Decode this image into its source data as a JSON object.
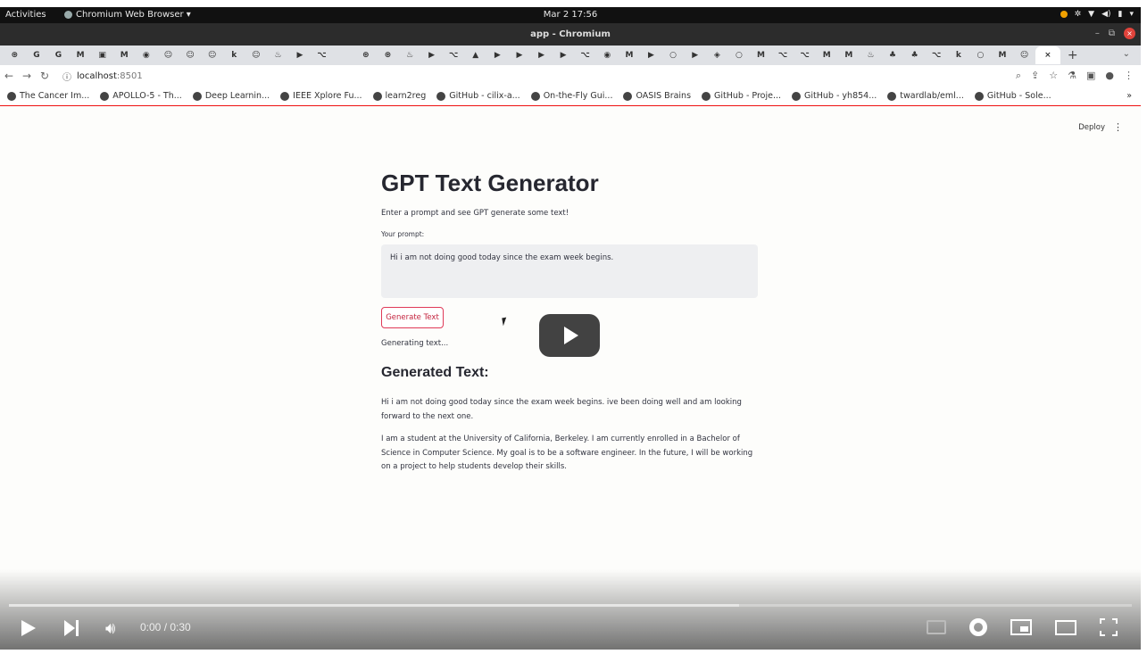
{
  "topbar": {
    "activities": "Activities",
    "app_menu": "Chromium Web Browser ▾",
    "clock": "Mar 2  17:56"
  },
  "window": {
    "title": "app - Chromium",
    "minimize": "–",
    "maximize": "⧉",
    "close": "×"
  },
  "tabs": {
    "icons": [
      "⊛",
      "G",
      "G",
      "M",
      "▣",
      "M",
      "◉",
      "☺",
      "☺",
      "☺",
      "k",
      "☺",
      "♨",
      "▶",
      "⌥",
      "",
      "⊛",
      "⊛",
      "♨",
      "▶",
      "⌥",
      "▲",
      "▶",
      "▶",
      "▶",
      "▶",
      "⌥",
      "◉",
      "M",
      "▶",
      "○",
      "▶",
      "◈",
      "○",
      "M",
      "⌥",
      "⌥",
      "M",
      "M",
      "♨",
      "♣",
      "♣",
      "⌥",
      "k",
      "○",
      "M",
      "☺"
    ],
    "active_label": "×",
    "new_tab": "+",
    "overflow": "⌄"
  },
  "address": {
    "back": "←",
    "forward": "→",
    "reload": "↻",
    "info": "ⓘ",
    "host": "localhost",
    "port": ":8501"
  },
  "bookmarks": [
    "The Cancer Im...",
    "APOLLO-5 - Th...",
    "Deep Learnin...",
    "IEEE Xplore Fu...",
    "learn2reg",
    "GitHub - cilix-a...",
    "On-the-Fly Gui...",
    "OASIS Brains",
    "GitHub - Proje...",
    "GitHub - yh854...",
    "twardlab/eml...",
    "GitHub - Sole..."
  ],
  "bookmarks_more": "»",
  "app": {
    "deploy": "Deploy",
    "menu": "⋮",
    "title": "GPT Text Generator",
    "subtitle": "Enter a prompt and see GPT generate some text!",
    "prompt_label": "Your prompt:",
    "prompt_value": "Hi i am not doing good today since the exam week begins.",
    "button_label": "Generate Text",
    "status": "Generating text...",
    "output_heading": "Generated Text:",
    "output_p1": "Hi i am not doing good today since the exam week begins. ive been doing well and am looking forward to the next one.",
    "output_p2": "I am a student at the University of California, Berkeley. I am currently enrolled in a Bachelor of Science in Computer Science. My goal is to be a software engineer. In the future, I will be working on a project to help students develop their skills."
  },
  "player": {
    "time": "0:00 / 0:30",
    "buffered_fraction": 0.65
  }
}
